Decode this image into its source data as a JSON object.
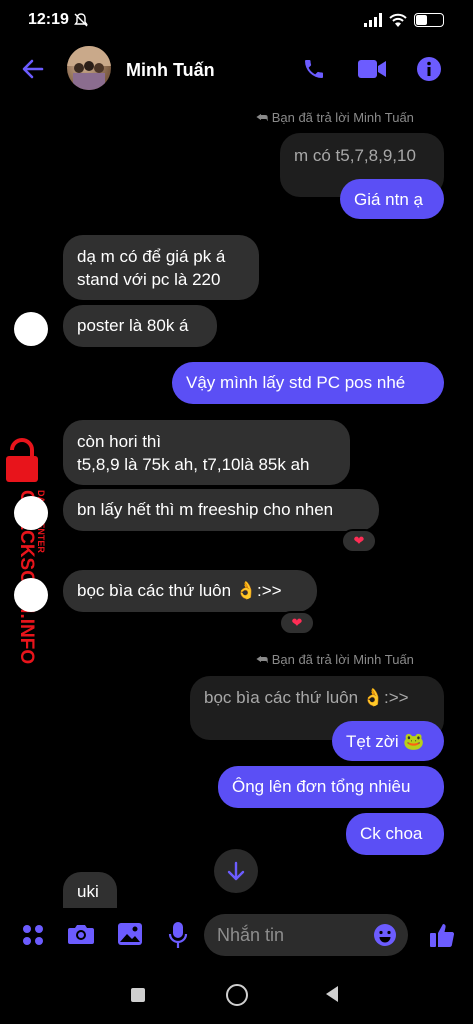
{
  "status_bar": {
    "time": "12:19",
    "battery": "30"
  },
  "header": {
    "contact_name": "Minh Tuấn"
  },
  "messages": {
    "reply_note_1": "Bạn đã trả lời Minh Tuấn",
    "quoted_1": "m có t5,7,8,9,10",
    "out_1": "Giá ntn ạ",
    "in_1_line1": "dạ m có để giá pk á",
    "in_1_line2": "stand với pc là 220",
    "in_2": "poster là 80k á",
    "out_2": "Vậy mình lấy std PC pos nhé",
    "in_3_line1": "còn hori thì",
    "in_3_line2": "t5,8,9 là 75k ah, t7,10là 85k ah",
    "in_4": "bn lấy hết thì m freeship cho nhen",
    "in_5": "bọc bìa các thứ luôn 👌:>>",
    "reply_note_2": "Bạn đã trả lời Minh Tuấn",
    "quoted_2": "bọc bìa các thứ luôn 👌:>>",
    "out_3": "Tẹt zời 🐸",
    "out_4": "Ông lên đơn tổng nhiêu",
    "out_5": "Ck choa",
    "in_6": "uki",
    "reaction": "❤"
  },
  "composer": {
    "placeholder": "Nhắn tin"
  },
  "watermark": {
    "title": "CHECKSCAM.INFO",
    "subtitle": "DATA CENTER"
  },
  "colors": {
    "accent": "#5b4ff5",
    "icon": "#6c5cff",
    "bubble_in": "#303030",
    "watermark": "#e8141b"
  }
}
